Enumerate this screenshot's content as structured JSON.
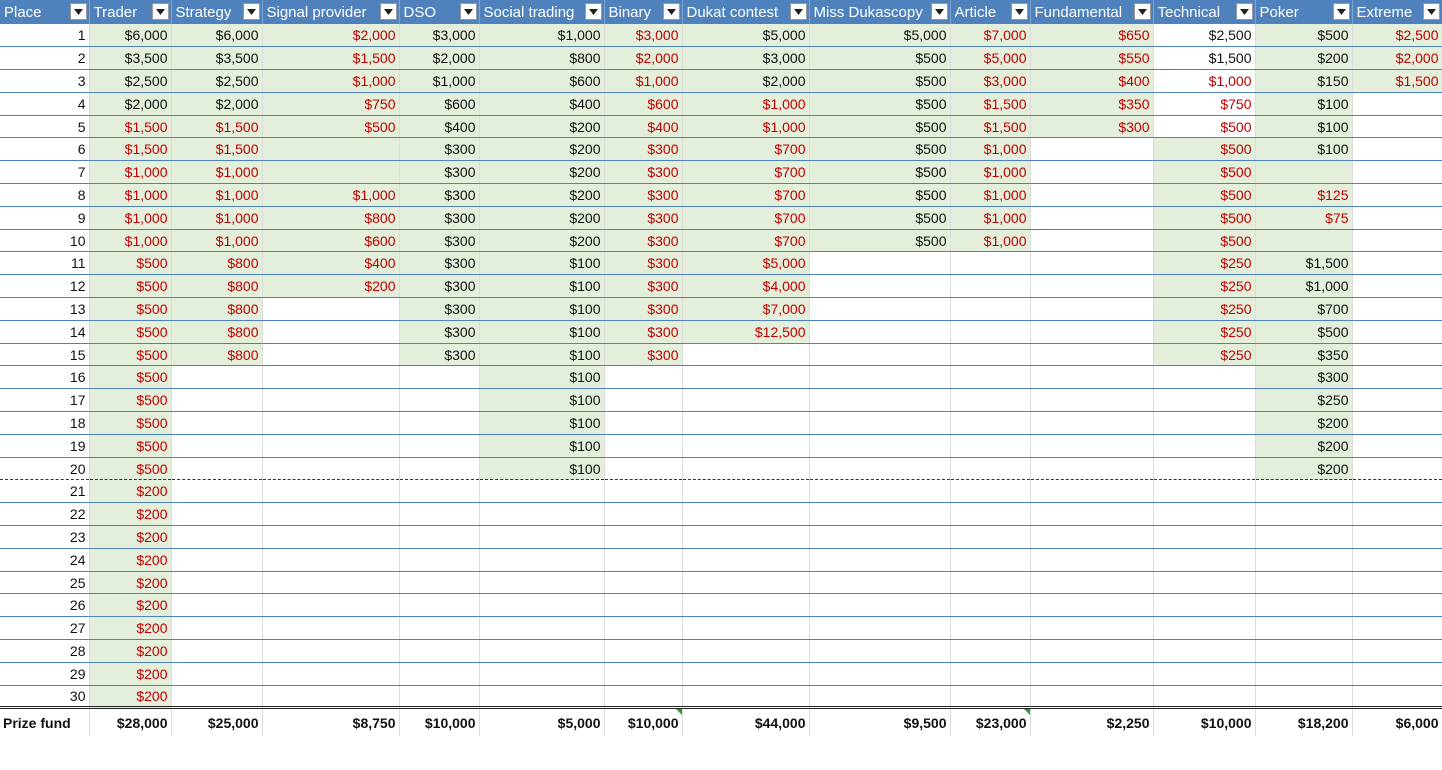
{
  "headers": [
    "Place",
    "Trader",
    "Strategy",
    "Signal provider",
    "DSO",
    "Social trading",
    "Binary",
    "Dukat contest",
    "Miss Dukascopy",
    "Article",
    "Fundamental",
    "Technical",
    "Poker",
    "Extreme"
  ],
  "colors": {
    "header_bg": "#4f81bd",
    "header_text": "#ffffff",
    "highlight_fill": "#e3efda",
    "red_text": "#c00000",
    "row_border": "#4f81bd"
  },
  "rows": [
    {
      "place": "1",
      "cells": [
        "$6,000",
        "$6,000",
        "$2,000",
        "$3,000",
        "$1,000",
        "$3,000",
        "$5,000",
        "$5,000",
        "$7,000",
        "$650",
        "$2,500",
        "$500",
        "$2,500"
      ]
    },
    {
      "place": "2",
      "cells": [
        "$3,500",
        "$3,500",
        "$1,500",
        "$2,000",
        "$800",
        "$2,000",
        "$3,000",
        "$500",
        "$5,000",
        "$550",
        "$1,500",
        "$200",
        "$2,000"
      ]
    },
    {
      "place": "3",
      "cells": [
        "$2,500",
        "$2,500",
        "$1,000",
        "$1,000",
        "$600",
        "$1,000",
        "$2,000",
        "$500",
        "$3,000",
        "$400",
        "$1,000",
        "$150",
        "$1,500"
      ]
    },
    {
      "place": "4",
      "cells": [
        "$2,000",
        "$2,000",
        "$750",
        "$600",
        "$400",
        "$600",
        "$1,000",
        "$500",
        "$1,500",
        "$350",
        "$750",
        "$100",
        ""
      ]
    },
    {
      "place": "5",
      "cells": [
        "$1,500",
        "$1,500",
        "$500",
        "$400",
        "$200",
        "$400",
        "$1,000",
        "$500",
        "$1,500",
        "$300",
        "$500",
        "$100",
        ""
      ]
    },
    {
      "place": "6",
      "cells": [
        "$1,500",
        "$1,500",
        "",
        "$300",
        "$200",
        "$300",
        "$700",
        "$500",
        "$1,000",
        "",
        "$500",
        "$100",
        ""
      ]
    },
    {
      "place": "7",
      "cells": [
        "$1,000",
        "$1,000",
        "",
        "$300",
        "$200",
        "$300",
        "$700",
        "$500",
        "$1,000",
        "",
        "$500",
        "",
        ""
      ]
    },
    {
      "place": "8",
      "cells": [
        "$1,000",
        "$1,000",
        "$1,000",
        "$300",
        "$200",
        "$300",
        "$700",
        "$500",
        "$1,000",
        "",
        "$500",
        "$125",
        ""
      ]
    },
    {
      "place": "9",
      "cells": [
        "$1,000",
        "$1,000",
        "$800",
        "$300",
        "$200",
        "$300",
        "$700",
        "$500",
        "$1,000",
        "",
        "$500",
        "$75",
        ""
      ]
    },
    {
      "place": "10",
      "cells": [
        "$1,000",
        "$1,000",
        "$600",
        "$300",
        "$200",
        "$300",
        "$700",
        "$500",
        "$1,000",
        "",
        "$500",
        "",
        ""
      ]
    },
    {
      "place": "11",
      "cells": [
        "$500",
        "$800",
        "$400",
        "$300",
        "$100",
        "$300",
        "$5,000",
        "",
        "",
        "",
        "$250",
        "$1,500",
        ""
      ]
    },
    {
      "place": "12",
      "cells": [
        "$500",
        "$800",
        "$200",
        "$300",
        "$100",
        "$300",
        "$4,000",
        "",
        "",
        "",
        "$250",
        "$1,000",
        ""
      ]
    },
    {
      "place": "13",
      "cells": [
        "$500",
        "$800",
        "",
        "$300",
        "$100",
        "$300",
        "$7,000",
        "",
        "",
        "",
        "$250",
        "$700",
        ""
      ]
    },
    {
      "place": "14",
      "cells": [
        "$500",
        "$800",
        "",
        "$300",
        "$100",
        "$300",
        "$12,500",
        "",
        "",
        "",
        "$250",
        "$500",
        ""
      ]
    },
    {
      "place": "15",
      "cells": [
        "$500",
        "$800",
        "",
        "$300",
        "$100",
        "$300",
        "",
        "",
        "",
        "",
        "$250",
        "$350",
        ""
      ]
    },
    {
      "place": "16",
      "cells": [
        "$500",
        "",
        "",
        "",
        "$100",
        "",
        "",
        "",
        "",
        "",
        "",
        "$300",
        ""
      ]
    },
    {
      "place": "17",
      "cells": [
        "$500",
        "",
        "",
        "",
        "$100",
        "",
        "",
        "",
        "",
        "",
        "",
        "$250",
        ""
      ]
    },
    {
      "place": "18",
      "cells": [
        "$500",
        "",
        "",
        "",
        "$100",
        "",
        "",
        "",
        "",
        "",
        "",
        "$200",
        ""
      ]
    },
    {
      "place": "19",
      "cells": [
        "$500",
        "",
        "",
        "",
        "$100",
        "",
        "",
        "",
        "",
        "",
        "",
        "$200",
        ""
      ]
    },
    {
      "place": "20",
      "cells": [
        "$500",
        "",
        "",
        "",
        "$100",
        "",
        "",
        "",
        "",
        "",
        "",
        "$200",
        ""
      ]
    },
    {
      "place": "21",
      "cells": [
        "$200",
        "",
        "",
        "",
        "",
        "",
        "",
        "",
        "",
        "",
        "",
        "",
        ""
      ]
    },
    {
      "place": "22",
      "cells": [
        "$200",
        "",
        "",
        "",
        "",
        "",
        "",
        "",
        "",
        "",
        "",
        "",
        ""
      ]
    },
    {
      "place": "23",
      "cells": [
        "$200",
        "",
        "",
        "",
        "",
        "",
        "",
        "",
        "",
        "",
        "",
        "",
        ""
      ]
    },
    {
      "place": "24",
      "cells": [
        "$200",
        "",
        "",
        "",
        "",
        "",
        "",
        "",
        "",
        "",
        "",
        "",
        ""
      ]
    },
    {
      "place": "25",
      "cells": [
        "$200",
        "",
        "",
        "",
        "",
        "",
        "",
        "",
        "",
        "",
        "",
        "",
        ""
      ]
    },
    {
      "place": "26",
      "cells": [
        "$200",
        "",
        "",
        "",
        "",
        "",
        "",
        "",
        "",
        "",
        "",
        "",
        ""
      ]
    },
    {
      "place": "27",
      "cells": [
        "$200",
        "",
        "",
        "",
        "",
        "",
        "",
        "",
        "",
        "",
        "",
        "",
        ""
      ]
    },
    {
      "place": "28",
      "cells": [
        "$200",
        "",
        "",
        "",
        "",
        "",
        "",
        "",
        "",
        "",
        "",
        "",
        ""
      ]
    },
    {
      "place": "29",
      "cells": [
        "$200",
        "",
        "",
        "",
        "",
        "",
        "",
        "",
        "",
        "",
        "",
        "",
        ""
      ]
    },
    {
      "place": "30",
      "cells": [
        "$200",
        "",
        "",
        "",
        "",
        "",
        "",
        "",
        "",
        "",
        "",
        "",
        ""
      ]
    }
  ],
  "footer": {
    "label": "Prize fund",
    "values": [
      "$28,000",
      "$25,000",
      "$8,750",
      "$10,000",
      "$5,000",
      "$10,000",
      "$44,000",
      "$9,500",
      "$23,000",
      "$2,250",
      "$10,000",
      "$18,200",
      "$6,000"
    ]
  }
}
